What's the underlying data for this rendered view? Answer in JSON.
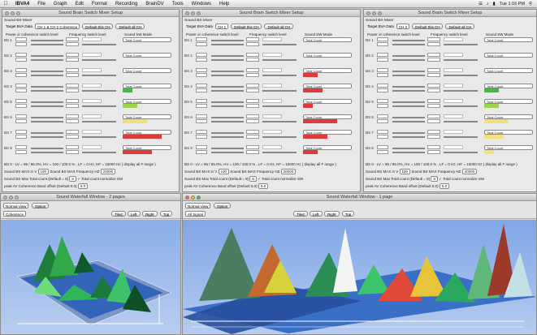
{
  "menubar": {
    "app": "IBVA4",
    "items": [
      "File",
      "Graph",
      "Edit",
      "Format",
      "Recording",
      "BrainDV",
      "Tools",
      "Windows",
      "Help"
    ],
    "clock": "Tue 1:16 PM"
  },
  "mixer_windows": [
    {
      "title": "Sound Brain Switch Mixer Setup",
      "panel": "Sound BS Mixer",
      "target_label": "Target BVA Data",
      "target_value": "CH 1 & CH 2 Coherence",
      "default_this_ch": "Default this CH",
      "default_all_ch": "Default all CH",
      "header_power": "Power or coherence switch level",
      "header_freq": "Frequency switch level",
      "header_mode": "Sound SW Mode",
      "rows": [
        {
          "label": "BS 1",
          "mode": "Total Count",
          "fill": 0.0,
          "bar_color": "#000000"
        },
        {
          "label": "BS 2",
          "mode": "Total Count",
          "fill": 0.0,
          "bar_color": "#000000"
        },
        {
          "label": "BS 3",
          "mode": "Total Count",
          "fill": 0.0,
          "bar_color": "#000000"
        },
        {
          "label": "BS 4",
          "mode": "Total Count",
          "fill": 0.2,
          "bar_color": "#35c435"
        },
        {
          "label": "BS 5",
          "mode": "Total Count",
          "fill": 0.3,
          "bar_color": "#9bd64a"
        },
        {
          "label": "BS 6",
          "mode": "Total Count",
          "fill": 0.5,
          "bar_color": "#f1e178"
        },
        {
          "label": "BS 7",
          "mode": "Total Count",
          "fill": 0.8,
          "bar_color": "#e03b3b"
        },
        {
          "label": "BS 8",
          "mode": "Total Count",
          "fill": 0.6,
          "bar_color": "#e03b3b"
        }
      ],
      "footer_line1": "BS 0 - LV = 95 / 95.0%, HV = 100 / 100.0 % , LF = 0 Hz, HF = 10000 Hz ( display all F range )",
      "sound_max_label": "Sound BS MAX in V",
      "sound_max_value": "100",
      "freq_max_label": "Sound BS MAX Frequency HZ",
      "freq_max_value": "20000",
      "total_count_label": "Sound BS Max Total count (Default = 8)",
      "total_count_value": "8",
      "normalize_label": "Total count normalize SW",
      "peak_label": "peak AV Coherence Band offset (Default 5.0)",
      "peak_value": "5.0"
    },
    {
      "title": "Sound Brain Switch Mixer Setup",
      "panel": "Sound BS Mixer",
      "target_label": "Target BVA Data",
      "target_value": "CH 1",
      "default_this_ch": "Default this CH",
      "default_all_ch": "Default all CH",
      "header_power": "Power or coherence switch level",
      "header_freq": "Frequency switch level",
      "header_mode": "Sound SW Mode",
      "rows": [
        {
          "label": "BS 1",
          "mode": "Total Count",
          "fill": 0.0,
          "bar_color": "#000000"
        },
        {
          "label": "BS 2",
          "mode": "Total Count",
          "fill": 0.0,
          "bar_color": "#000000"
        },
        {
          "label": "BS 3",
          "mode": "Total Count",
          "fill": 0.3,
          "bar_color": "#e03b3b"
        },
        {
          "label": "BS 4",
          "mode": "Total Count",
          "fill": 0.4,
          "bar_color": "#e03b3b"
        },
        {
          "label": "BS 5",
          "mode": "Total Count",
          "fill": 0.2,
          "bar_color": "#e03b3b"
        },
        {
          "label": "BS 6",
          "mode": "Total Count",
          "fill": 0.7,
          "bar_color": "#e03b3b"
        },
        {
          "label": "BS 7",
          "mode": "Total Count",
          "fill": 0.5,
          "bar_color": "#e03b3b"
        },
        {
          "label": "BS 8",
          "mode": "Total Count",
          "fill": 0.3,
          "bar_color": "#e03b3b"
        }
      ],
      "footer_line1": "BS 0 - LV = 95 / 95.0%, HV = 100 / 100.0 % , LF = 0 Hz, HF = 10000 Hz ( display all F range )",
      "sound_max_label": "Sound BS MAX in V",
      "sound_max_value": "100",
      "freq_max_label": "Sound BS MAX Frequency HZ",
      "freq_max_value": "20000",
      "total_count_label": "Sound BS Max Total count (Default = 8)",
      "total_count_value": "8",
      "normalize_label": "Total count normalize SW",
      "peak_label": "peak AV Coherence Band offset (Default 5.0)",
      "peak_value": "5.0"
    },
    {
      "title": "Sound Brain Switch Mixer Setup",
      "panel": "Sound BS Mixer",
      "target_label": "Target BVA Data",
      "target_value": "CH 2",
      "default_this_ch": "Default this CH",
      "default_all_ch": "Default all CH",
      "header_power": "Power or coherence switch level",
      "header_freq": "Frequency switch level",
      "header_mode": "Sound SW Mode",
      "rows": [
        {
          "label": "BS 1",
          "mode": "Total Count",
          "fill": 0.0,
          "bar_color": "#000000"
        },
        {
          "label": "BS 2",
          "mode": "Total Count",
          "fill": 0.0,
          "bar_color": "#000000"
        },
        {
          "label": "BS 3",
          "mode": "Total Count",
          "fill": 0.0,
          "bar_color": "#000000"
        },
        {
          "label": "BS 4",
          "mode": "Total Count",
          "fill": 0.3,
          "bar_color": "#35c435"
        },
        {
          "label": "BS 5",
          "mode": "Total Count",
          "fill": 0.3,
          "bar_color": "#9bd64a"
        },
        {
          "label": "BS 6",
          "mode": "Total Count",
          "fill": 0.5,
          "bar_color": "#f1e178"
        },
        {
          "label": "BS 7",
          "mode": "Total Count",
          "fill": 0.4,
          "bar_color": "#f1e178"
        },
        {
          "label": "BS 8",
          "mode": "Total Count",
          "fill": 0.2,
          "bar_color": "#f1e178"
        }
      ],
      "footer_line1": "BS 0 - LV = 95 / 95.0%, HV = 100 / 100.0 % , LF = 0 Hz, HF = 10000 Hz ( display all F range )",
      "sound_max_label": "Sound BS MAX in V",
      "sound_max_value": "100",
      "freq_max_label": "Sound BS MAX Frequency HZ",
      "freq_max_value": "20000",
      "total_count_label": "Sound BS Max Total count (Default = 8)",
      "total_count_value": "8",
      "normalize_label": "Total count normalize SW",
      "peak_label": "peak AV Coherence Band offset (Default 5.0)",
      "peak_value": "5.0"
    }
  ],
  "waterfall_small": {
    "title": "Sound Waterfall Window - 2 pages",
    "view_mode": "Normal View",
    "option_label": "Option",
    "channel": "Coherence",
    "btn_tiled": "Tiled",
    "btn_left": "Left",
    "btn_right": "Right",
    "btn_top": "Top"
  },
  "waterfall_large": {
    "title": "Sound Waterfall Window - 1 page",
    "view_mode": "Normal View",
    "option_label": "Option",
    "channel": "All Signal",
    "btn_tiled": "Tiled",
    "btn_left": "Left",
    "btn_right": "Right",
    "btn_top": "Top"
  }
}
